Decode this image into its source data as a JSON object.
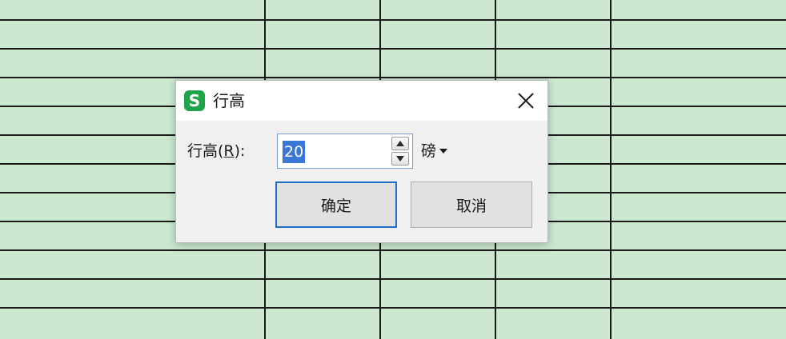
{
  "dialog": {
    "title": "行高",
    "app_icon_letter": "S",
    "field_label_prefix": "行高(",
    "field_label_key": "R",
    "field_label_suffix": "):",
    "row_height_value": "20",
    "unit": "磅",
    "ok_label": "确定",
    "cancel_label": "取消"
  },
  "colors": {
    "sheet_background": "#cce8cf",
    "app_icon": "#1fa44a",
    "ok_border": "#1f6fc8",
    "selection": "#3a78d8"
  },
  "icons": [
    "app-logo-icon",
    "close-icon",
    "spin-up-icon",
    "spin-down-icon",
    "caret-down-icon"
  ]
}
